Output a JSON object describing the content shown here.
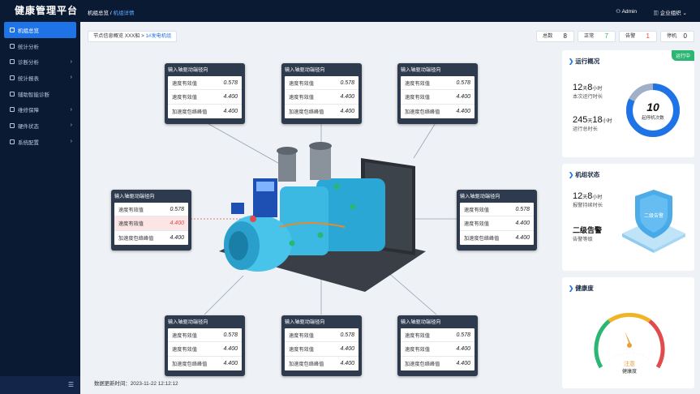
{
  "app": {
    "title": "健康管理平台"
  },
  "sidebar": {
    "items": [
      {
        "label": "机组总览",
        "icon": "grid-icon",
        "active": true,
        "expandable": false
      },
      {
        "label": "统计分析",
        "icon": "chart-icon",
        "active": false,
        "expandable": false
      },
      {
        "label": "诊断分析",
        "icon": "diagnose-icon",
        "active": false,
        "expandable": true
      },
      {
        "label": "统计报表",
        "icon": "report-icon",
        "active": false,
        "expandable": true
      },
      {
        "label": "辅助智能诊断",
        "icon": "ai-icon",
        "active": false,
        "expandable": false
      },
      {
        "label": "维修保障",
        "icon": "wrench-icon",
        "active": false,
        "expandable": true
      },
      {
        "label": "硬件状态",
        "icon": "hardware-icon",
        "active": false,
        "expandable": true
      },
      {
        "label": "系统配置",
        "icon": "settings-icon",
        "active": false,
        "expandable": true
      }
    ],
    "collapse_icon": "menu-collapse-icon",
    "chevron": "›"
  },
  "header": {
    "breadcrumb_root": "机组总览",
    "breadcrumb_sep": "/",
    "breadcrumb_current": "机组详情",
    "user": "Admin",
    "org": "企业组织"
  },
  "node_path": {
    "prefix": "节点信息概览 XXX船 >",
    "link": "1#发电机组"
  },
  "counters": [
    {
      "label": "总数",
      "value": "8",
      "color": "#222222"
    },
    {
      "label": "正常",
      "value": "7",
      "color": "#2bb673"
    },
    {
      "label": "告警",
      "value": "1",
      "color": "#e14b4b"
    },
    {
      "label": "停机",
      "value": "0",
      "color": "#222222"
    }
  ],
  "sensors": [
    {
      "title": "输入轴驱动端径向",
      "rows": [
        {
          "label": "速度有效值",
          "value": "0.578"
        },
        {
          "label": "速度有效值",
          "value": "4.400"
        },
        {
          "label": "加速度包络峰值",
          "value": "4.400"
        }
      ]
    },
    {
      "title": "输入轴驱动端径向",
      "rows": [
        {
          "label": "速度有效值",
          "value": "0.578"
        },
        {
          "label": "速度有效值",
          "value": "4.400"
        },
        {
          "label": "加速度包络峰值",
          "value": "4.400"
        }
      ]
    },
    {
      "title": "输入轴驱动端径向",
      "rows": [
        {
          "label": "速度有效值",
          "value": "0.578"
        },
        {
          "label": "速度有效值",
          "value": "4.400"
        },
        {
          "label": "加速度包络峰值",
          "value": "4.400"
        }
      ]
    },
    {
      "title": "输入轴驱动端径向",
      "rows": [
        {
          "label": "速度有效值",
          "value": "0.578"
        },
        {
          "label": "速度有效值",
          "value": "4.400",
          "alert": true
        },
        {
          "label": "加速度包络峰值",
          "value": "4.400"
        }
      ]
    },
    {
      "title": "输入轴驱动端径向",
      "rows": [
        {
          "label": "速度有效值",
          "value": "0.578"
        },
        {
          "label": "速度有效值",
          "value": "4.400"
        },
        {
          "label": "加速度包络峰值",
          "value": "4.400"
        }
      ]
    },
    {
      "title": "输入轴驱动端径向",
      "rows": [
        {
          "label": "速度有效值",
          "value": "0.578"
        },
        {
          "label": "速度有效值",
          "value": "4.400"
        },
        {
          "label": "加速度包络峰值",
          "value": "4.400"
        }
      ]
    },
    {
      "title": "输入轴驱动端径向",
      "rows": [
        {
          "label": "速度有效值",
          "value": "0.578"
        },
        {
          "label": "速度有效值",
          "value": "4.400"
        },
        {
          "label": "加速度包络峰值",
          "value": "4.400"
        }
      ]
    },
    {
      "title": "输入轴驱动端径向",
      "rows": [
        {
          "label": "速度有效值",
          "value": "0.578"
        },
        {
          "label": "速度有效值",
          "value": "4.400"
        },
        {
          "label": "加速度包络峰值",
          "value": "4.400"
        }
      ]
    }
  ],
  "update": {
    "label": "数据更新时间：",
    "time": "2023-11-22 12:12:12"
  },
  "operation": {
    "title": "运行概况",
    "badge": "运行中",
    "current_days": "12",
    "current_hours": "8",
    "unit_day": "天",
    "unit_hour": "小时",
    "current_label": "本次运行时长",
    "total_days": "245",
    "total_hours": "18",
    "total_label": "运行总时长",
    "starts": "10",
    "starts_label": "起停机次数",
    "donut_fraction": 0.82,
    "donut_color": "#1e74e6"
  },
  "unit_state": {
    "title": "机组状态",
    "alarm_days": "12",
    "alarm_hours": "8",
    "alarm_label": "报警持续时长",
    "level": "二级告警",
    "level_label": "告警等级",
    "shield_text": "二级告警"
  },
  "health": {
    "title": "健康度",
    "status": "注意",
    "label": "健康度",
    "gauge_fraction": 0.4,
    "status_color": "#e8a13a"
  },
  "colors": {
    "accent": "#1e74e6",
    "sidebar": "#0b1a33",
    "normal": "#2bb673",
    "alarm": "#e14b4b",
    "panel": "#2e3a4d"
  }
}
